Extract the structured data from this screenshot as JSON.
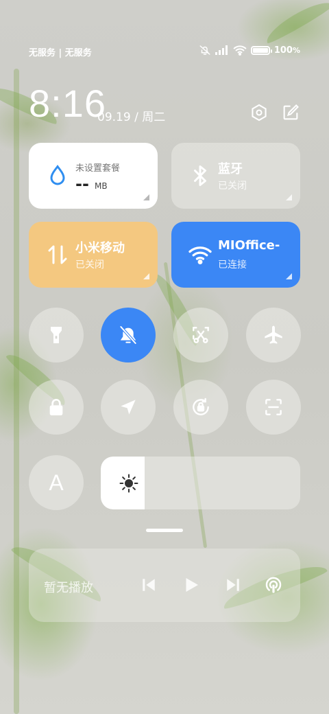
{
  "status_bar": {
    "carrier": "无服务 | 无服务",
    "battery_percent": "100",
    "battery_suffix": "%",
    "icons": [
      "bell-off-icon",
      "signal-icon",
      "wifi-icon",
      "battery-icon"
    ]
  },
  "header": {
    "time": "8:16",
    "date": "09.19 / 周二",
    "icons": [
      "settings-icon",
      "edit-icon"
    ]
  },
  "tiles": {
    "data_usage": {
      "title": "未设置套餐",
      "value": "--",
      "unit": "MB",
      "icon": "water-drop-icon"
    },
    "bluetooth": {
      "title": "蓝牙",
      "status": "已关闭",
      "icon": "bluetooth-icon"
    },
    "mobile_data": {
      "title": "小米移动",
      "status": "已关闭",
      "icon": "data-arrows-icon",
      "color": "#f4c880"
    },
    "wifi": {
      "title": "MIOffice-",
      "status": "已连接",
      "icon": "wifi-icon",
      "color": "#3b87f5"
    }
  },
  "toggles": [
    {
      "name": "flashlight",
      "icon": "flashlight-icon",
      "active": false
    },
    {
      "name": "silent",
      "icon": "bell-off-icon",
      "active": true
    },
    {
      "name": "screenshot",
      "icon": "scissors-screenshot-icon",
      "active": false
    },
    {
      "name": "airplane",
      "icon": "airplane-icon",
      "active": false
    },
    {
      "name": "lock",
      "icon": "lock-icon",
      "active": false
    },
    {
      "name": "location",
      "icon": "location-arrow-icon",
      "active": false
    },
    {
      "name": "rotation-lock",
      "icon": "rotation-lock-icon",
      "active": false
    },
    {
      "name": "scanner",
      "icon": "scan-icon",
      "active": false
    }
  ],
  "font_toggle": {
    "label": "A"
  },
  "brightness": {
    "level": 0.22,
    "icon": "sun-icon"
  },
  "media": {
    "label": "暂无播放",
    "controls": [
      "previous-icon",
      "play-icon",
      "next-icon",
      "cast-icon"
    ]
  },
  "colors": {
    "accent": "#3b87f5",
    "mobile": "#f4c880"
  }
}
